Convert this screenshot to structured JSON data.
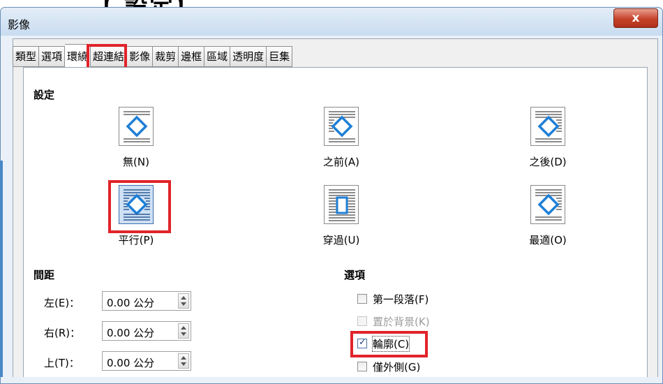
{
  "caption": "【 設定】",
  "window": {
    "title": "影像",
    "close_label": "x"
  },
  "tabs": [
    {
      "label": "類型"
    },
    {
      "label": "選項"
    },
    {
      "label": "環繞"
    },
    {
      "label": "超連結"
    },
    {
      "label": "影像"
    },
    {
      "label": "裁剪"
    },
    {
      "label": "邊框"
    },
    {
      "label": "區域"
    },
    {
      "label": "透明度"
    },
    {
      "label": "巨集"
    }
  ],
  "active_tab": "環繞",
  "settings": {
    "heading": "設定",
    "options": [
      {
        "label": "無(N)",
        "icon": "wrap-none-icon"
      },
      {
        "label": "之前(A)",
        "icon": "wrap-before-icon"
      },
      {
        "label": "之後(D)",
        "icon": "wrap-after-icon"
      },
      {
        "label": "平行(P)",
        "icon": "wrap-parallel-icon",
        "selected": true
      },
      {
        "label": "穿過(U)",
        "icon": "wrap-through-icon"
      },
      {
        "label": "最適(O)",
        "icon": "wrap-optimal-icon"
      }
    ]
  },
  "spacing": {
    "heading": "間距",
    "rows": [
      {
        "label": "左(E)：",
        "value": "0.00 公分"
      },
      {
        "label": "右(R)：",
        "value": "0.00 公分"
      },
      {
        "label": "上(T)：",
        "value": "0.00 公分"
      }
    ]
  },
  "options": {
    "heading": "選項",
    "items": [
      {
        "label": "第一段落(F)",
        "checked": false,
        "enabled": true
      },
      {
        "label": "置於背景(K)",
        "checked": false,
        "enabled": false
      },
      {
        "label": "輪廓(C)",
        "checked": true,
        "enabled": true
      },
      {
        "label": "僅外側(G)",
        "checked": false,
        "enabled": true
      }
    ]
  },
  "colors": {
    "highlight": "#e0242a",
    "accent": "#1e7fd6",
    "selected_bg": "#cfe0f4"
  }
}
